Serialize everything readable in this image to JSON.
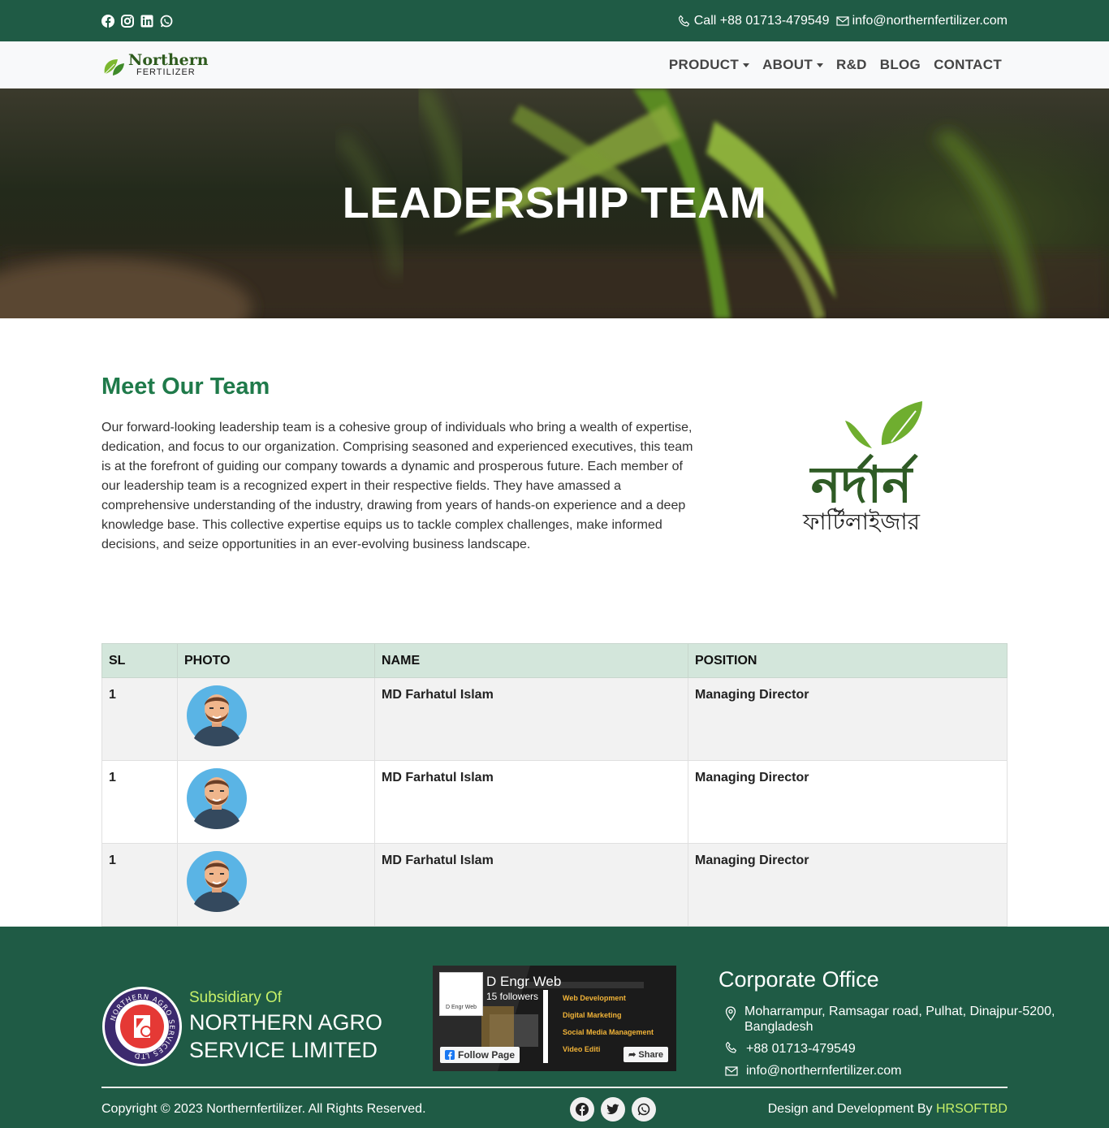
{
  "topbar": {
    "social_icons": [
      "facebook-icon",
      "instagram-icon",
      "linkedin-icon",
      "whatsapp-icon"
    ],
    "phone": "Call +88 01713-479549",
    "email": "info@northernfertilizer.com"
  },
  "nav": {
    "logo_line1": "Northern",
    "logo_line2": "FERTILIZER",
    "items": [
      {
        "label": "PRODUCT",
        "dropdown": true
      },
      {
        "label": "ABOUT",
        "dropdown": true
      },
      {
        "label": "R&D",
        "dropdown": false
      },
      {
        "label": "BLOG",
        "dropdown": false
      },
      {
        "label": "CONTACT",
        "dropdown": false
      }
    ]
  },
  "hero": {
    "title": "LEADERSHIP TEAM"
  },
  "intro": {
    "heading": "Meet Our Team",
    "body": "Our forward-looking leadership team is a cohesive group of individuals who bring a wealth of expertise, dedication, and focus to our organization. Comprising seasoned and experienced executives, this team is at the forefront of guiding our company towards a dynamic and prosperous future. Each member of our leadership team is a recognized expert in their respective fields. They have amassed a comprehensive understanding of the industry, drawing from years of hands-on experience and a deep knowledge base. This collective expertise equips us to tackle complex challenges, make informed decisions, and seize opportunities in an ever-evolving business landscape.",
    "bangla_logo_line1": "নর্দার্ন",
    "bangla_logo_line2": "ফার্টিলাইজার"
  },
  "table": {
    "headers": [
      "SL",
      "PHOTO",
      "NAME",
      "POSITION"
    ],
    "rows": [
      {
        "sl": "1",
        "name": "MD Farhatul Islam",
        "position": "Managing Director"
      },
      {
        "sl": "1",
        "name": "MD Farhatul Islam",
        "position": "Managing Director"
      },
      {
        "sl": "1",
        "name": "MD Farhatul Islam",
        "position": "Managing Director"
      }
    ]
  },
  "footer": {
    "subsidiary_label": "Subsidiary Of",
    "company_line1": "NORTHERN AGRO",
    "company_line2": "SERVICE LIMITED",
    "seal_text": "NORTHERN AGRO SERVICES LTD",
    "fb_page": {
      "name": "D Engr Web",
      "followers": "15 followers",
      "pic_label": "D Engr Web",
      "follow_label": "Follow Page",
      "share_label": "Share",
      "services": [
        "Web Development",
        "Digital Marketing",
        "Social Media Management",
        "Video Editi"
      ]
    },
    "office": {
      "title": "Corporate Office",
      "address": "Moharrampur, Ramsagar road, Pulhat, Dinajpur-5200, Bangladesh",
      "phone": "+88 01713-479549",
      "email": "info@northernfertilizer.com"
    },
    "copyright": "Copyright © 2023 Northernfertilizer. All Rights Reserved.",
    "credit_prefix": "Design and Development By",
    "credit_link": "HRSOFTBD",
    "bottom_icons": [
      "facebook-icon",
      "twitter-icon",
      "whatsapp-icon"
    ]
  },
  "colors": {
    "primary": "#1f5b45",
    "accent": "#c6f068",
    "heading": "#1f7a4a",
    "table_header": "#d3e6db"
  }
}
